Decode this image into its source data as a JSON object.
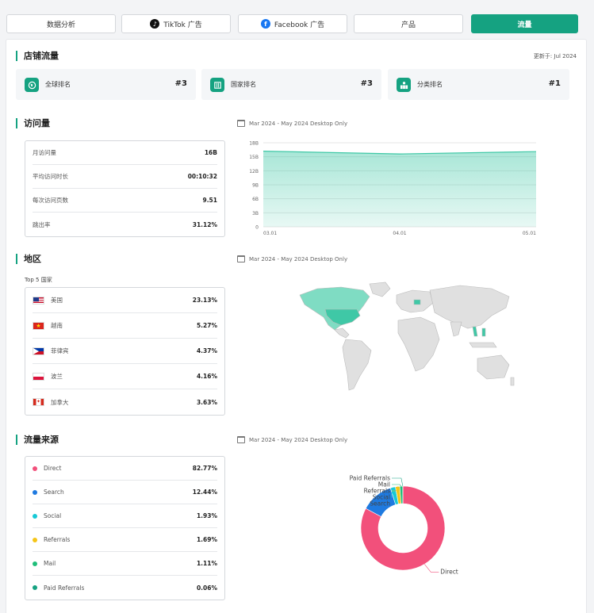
{
  "tabs": [
    {
      "label": "数据分析",
      "icon": "",
      "active": false
    },
    {
      "label": "TikTok 广告",
      "icon": "tiktok-icon",
      "active": false
    },
    {
      "label": "Facebook 广告",
      "icon": "facebook-icon",
      "active": false
    },
    {
      "label": "产品",
      "icon": "",
      "active": false
    },
    {
      "label": "流量",
      "icon": "",
      "active": true
    }
  ],
  "store_traffic": {
    "title": "店铺流量",
    "updated": "更新于: Jul 2024",
    "ranks": [
      {
        "label": "全球排名",
        "value": "#3",
        "icon": "globe-rank-icon"
      },
      {
        "label": "国家排名",
        "value": "#3",
        "icon": "flag-rank-icon"
      },
      {
        "label": "分类排名",
        "value": "#1",
        "icon": "category-rank-icon"
      }
    ]
  },
  "visits": {
    "title": "访问量",
    "period": "Mar 2024 - May 2024 Desktop Only",
    "metrics": [
      {
        "label": "月访问量",
        "value": "16B"
      },
      {
        "label": "平均访问时长",
        "value": "00:10:32"
      },
      {
        "label": "每次访问页数",
        "value": "9.51"
      },
      {
        "label": "跳出率",
        "value": "31.12%"
      }
    ]
  },
  "region": {
    "title": "地区",
    "period": "Mar 2024 - May 2024 Desktop Only",
    "top5_label": "Top 5 国家",
    "countries": [
      {
        "name": "美国",
        "value": "23.13%",
        "flag": "us"
      },
      {
        "name": "越南",
        "value": "5.27%",
        "flag": "vn"
      },
      {
        "name": "菲律宾",
        "value": "4.37%",
        "flag": "ph"
      },
      {
        "name": "波兰",
        "value": "4.16%",
        "flag": "pl"
      },
      {
        "name": "加拿大",
        "value": "3.63%",
        "flag": "ca"
      }
    ]
  },
  "sources": {
    "title": "流量来源",
    "period": "Mar 2024 - May 2024 Desktop Only",
    "items": [
      {
        "name": "Direct",
        "value": "82.77%",
        "color": "#f2507b"
      },
      {
        "name": "Search",
        "value": "12.44%",
        "color": "#1f7ae0"
      },
      {
        "name": "Social",
        "value": "1.93%",
        "color": "#17c9d6"
      },
      {
        "name": "Referrals",
        "value": "1.69%",
        "color": "#f5c518"
      },
      {
        "name": "Mail",
        "value": "1.11%",
        "color": "#1fbe7a"
      },
      {
        "name": "Paid Referrals",
        "value": "0.06%",
        "color": "#15a281"
      }
    ]
  },
  "chart_data": [
    {
      "type": "area",
      "x": [
        "03.01",
        "04.01",
        "05.01"
      ],
      "values": [
        16.2,
        15.6,
        16.1
      ],
      "ylim": [
        0,
        18
      ],
      "yticks": [
        "0",
        "3B",
        "6B",
        "9B",
        "12B",
        "15B",
        "18B"
      ],
      "grid": true,
      "color": "#3fc8a6"
    },
    {
      "type": "pie",
      "categories": [
        "Direct",
        "Search",
        "Social",
        "Referrals",
        "Mail",
        "Paid Referrals"
      ],
      "values": [
        82.77,
        12.44,
        1.93,
        1.69,
        1.11,
        0.06
      ],
      "colors": [
        "#f2507b",
        "#1f7ae0",
        "#17c9d6",
        "#f5c518",
        "#1fbe7a",
        "#15a281"
      ]
    }
  ]
}
